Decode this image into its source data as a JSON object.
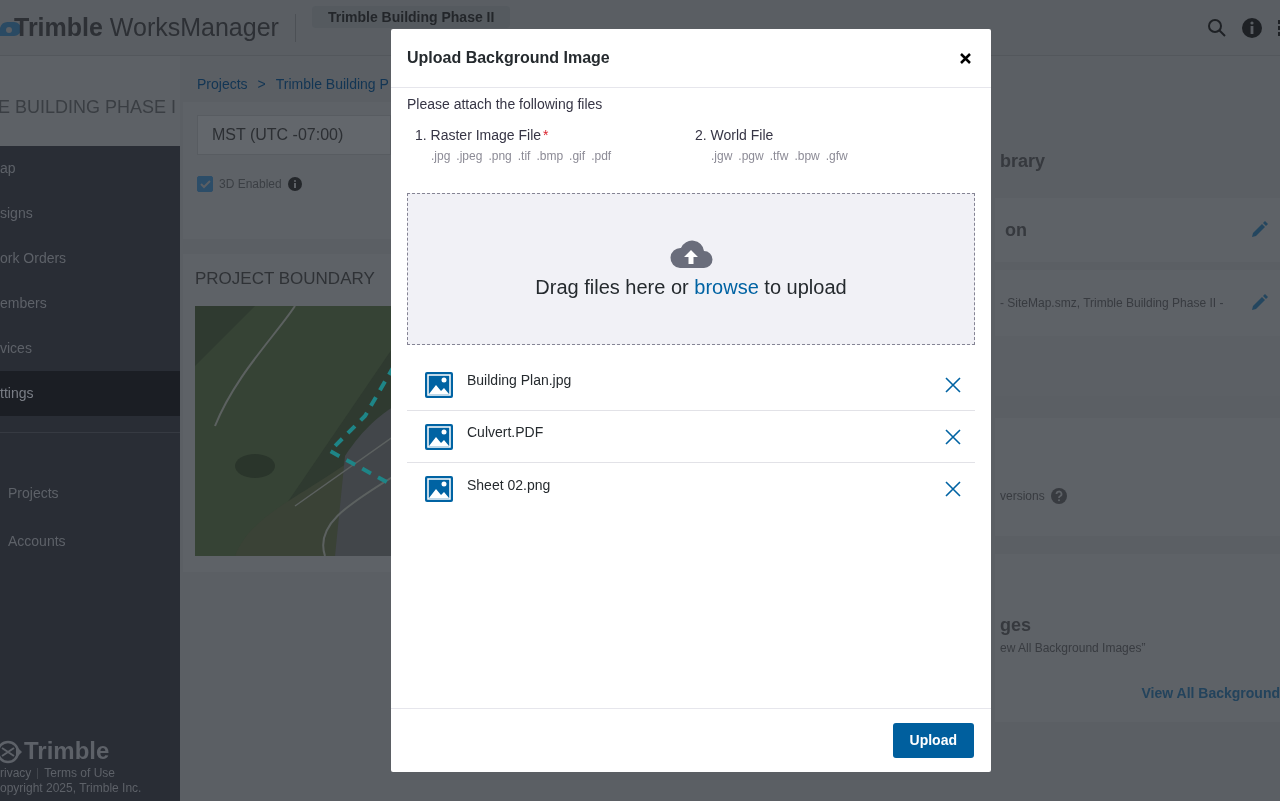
{
  "header": {
    "brand": "Trimble",
    "product": "WorksManager",
    "project_selector": "Trimble Building Phase II"
  },
  "sidebar": {
    "project_title": "E BUILDING PHASE I",
    "items": [
      {
        "label": "ap",
        "selected": false
      },
      {
        "label": "signs",
        "selected": false
      },
      {
        "label": "ork Orders",
        "selected": false
      },
      {
        "label": "embers",
        "selected": false
      },
      {
        "label": "vices",
        "selected": false
      },
      {
        "label": "ttings",
        "selected": true
      }
    ],
    "links": [
      "Projects",
      "Accounts"
    ],
    "footer": {
      "logo": "Trimble",
      "links": [
        "rivacy",
        "Terms of Use"
      ],
      "copyright": "opyright 2025, Trimble Inc."
    }
  },
  "main": {
    "breadcrumb": [
      "Projects",
      "Trimble Building P"
    ],
    "breadcrumb_separator": ">",
    "timezone": "MST (UTC -07:00)",
    "option": {
      "label": "3D Enabled",
      "checked": true
    },
    "boundary_title": "PROJECT BOUNDARY",
    "map": {
      "kind": "picture"
    }
  },
  "right_panel": {
    "heading_1": "brary",
    "heading_2": "on",
    "file_list": "- SiteMap.smz, Trimble Building Phase II -",
    "versions_label": "versions",
    "heading_3": "ges",
    "hint": "ew All Background Images”",
    "link": "View All Background"
  },
  "modal": {
    "title": "Upload Background Image",
    "intro": "Please attach the following files",
    "required_symbol": "*",
    "requirements": [
      {
        "label": "1. Raster Image File",
        "required": true,
        "extensions": [
          ".jpg",
          ".jpeg",
          ".png",
          ".tif",
          ".bmp",
          ".gif",
          ".pdf"
        ]
      },
      {
        "label": "2. World File",
        "required": false,
        "extensions": [
          ".jgw",
          ".pgw",
          ".tfw",
          ".bpw",
          ".gfw"
        ]
      }
    ],
    "dropzone": {
      "text_before": "Drag files here or",
      "link": "browse",
      "text_after": "to upload"
    },
    "files": [
      {
        "name": "Building Plan.jpg"
      },
      {
        "name": "Culvert.PDF"
      },
      {
        "name": "Sheet 02.png"
      }
    ],
    "button": "Upload"
  }
}
